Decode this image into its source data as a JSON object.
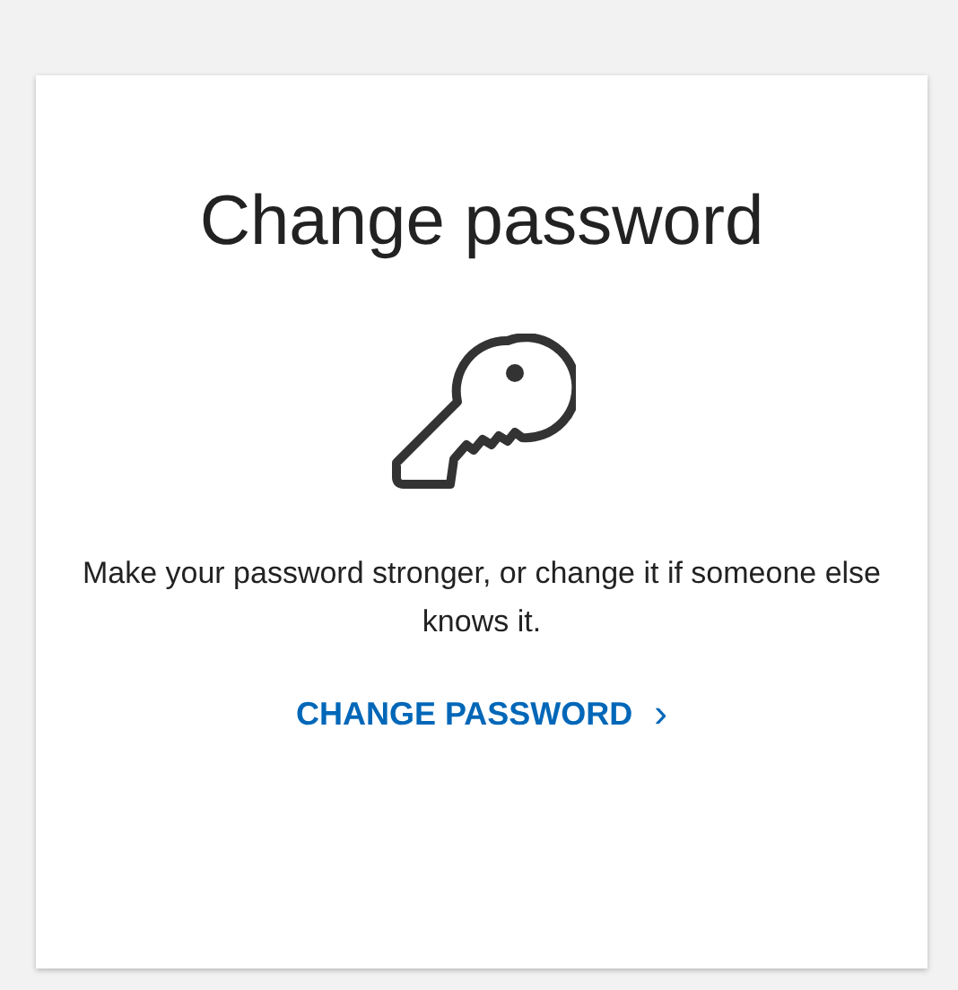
{
  "card": {
    "title": "Change password",
    "description": "Make your password stronger, or change it if someone else knows it.",
    "link": {
      "label": "CHANGE PASSWORD",
      "chevron": "›"
    }
  }
}
